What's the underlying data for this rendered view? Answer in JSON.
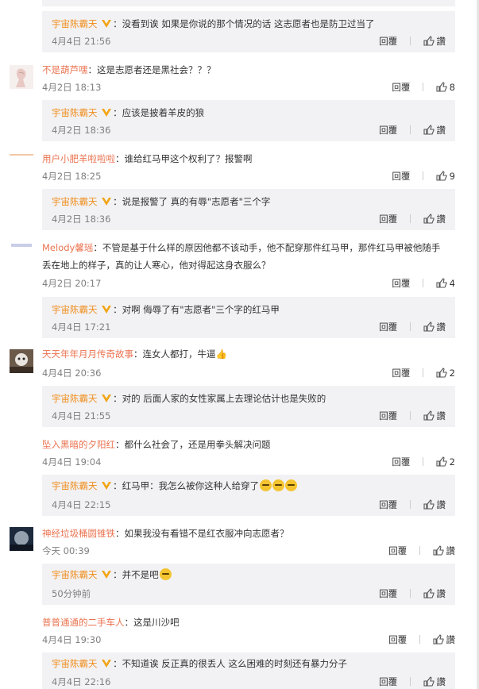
{
  "ui": {
    "reply_label": "回覆",
    "like_label": "讚",
    "colon": "："
  },
  "comments": [
    {
      "type": "reply",
      "author": "宇宙陈霸天",
      "verified": true,
      "text": "没看到诶 如果是你说的那个情况的话 这志愿者也是防卫过当了",
      "time": "4月4日 21:56",
      "likes": ""
    },
    {
      "type": "comment",
      "author": "不是葫芦嘿",
      "text": "这是志愿者还是黑社会？？？",
      "time": "4月2日 18:13",
      "likes": "8"
    },
    {
      "type": "reply",
      "author": "宇宙陈霸天",
      "verified": true,
      "text": "应该是披着羊皮的狼",
      "time": "4月2日 18:36",
      "likes": ""
    },
    {
      "type": "comment",
      "author": "用户小肥羊啦啦啦",
      "text": "谁给红马甲这个权利了？报警啊",
      "time": "4月2日 18:25",
      "likes": "9"
    },
    {
      "type": "reply",
      "author": "宇宙陈霸天",
      "verified": true,
      "text": "说是报警了 真的有辱\"志愿者\"三个字",
      "time": "4月2日 18:36",
      "likes": ""
    },
    {
      "type": "comment",
      "author": "Melody馨瑶",
      "text_line1": "不管是基于什么样的原因他都不该动手，他不配穿那件红马甲，那件红马甲被他随手",
      "text_line2": "丢在地上的样子，真的让人寒心，他对得起这身衣服么？",
      "time": "4月2日 20:17",
      "likes": "4"
    },
    {
      "type": "reply",
      "author": "宇宙陈霸天",
      "verified": true,
      "text": "对啊 侮辱了有\"志愿者\"三个字的红马甲",
      "time": "4月4日 17:21",
      "likes": ""
    },
    {
      "type": "comment",
      "author": "天天年年月月传奇故事",
      "text": "连女人都打，牛逼👍",
      "time": "4月4日 20:36",
      "likes": "2"
    },
    {
      "type": "reply",
      "author": "宇宙陈霸天",
      "verified": true,
      "text": "对的 后面人家的女性家属上去理论估计也是失败的",
      "time": "4月4日 21:55",
      "likes": ""
    },
    {
      "type": "comment",
      "author": "坠入黑暗的夕阳红",
      "text": "都什么社会了，还是用拳头解决问题",
      "time": "4月4日 19:04",
      "likes": "2"
    },
    {
      "type": "reply",
      "author": "宇宙陈霸天",
      "verified": true,
      "text": "红马甲：我怎么被你这种人给穿了",
      "time": "4月4日 22:15",
      "likes": ""
    },
    {
      "type": "comment",
      "author": "神经垃圾桶圆锥铁",
      "text": "如果我没有看错不是红衣服冲向志愿者？",
      "time": "今天 00:39",
      "likes": ""
    },
    {
      "type": "reply",
      "author": "宇宙陈霸天",
      "verified": true,
      "text": "并不是吧",
      "time": "50分钟前",
      "likes": ""
    },
    {
      "type": "comment",
      "author": "普普通通的二手车人",
      "text": "这是川沙吧",
      "time": "4月4日 19:30",
      "likes": ""
    },
    {
      "type": "reply",
      "author": "宇宙陈霸天",
      "verified": true,
      "text": "不知道诶 反正真的很丢人 这么困难的时刻还有暴力分子",
      "time": "4月4日 22:16",
      "likes": ""
    }
  ]
}
